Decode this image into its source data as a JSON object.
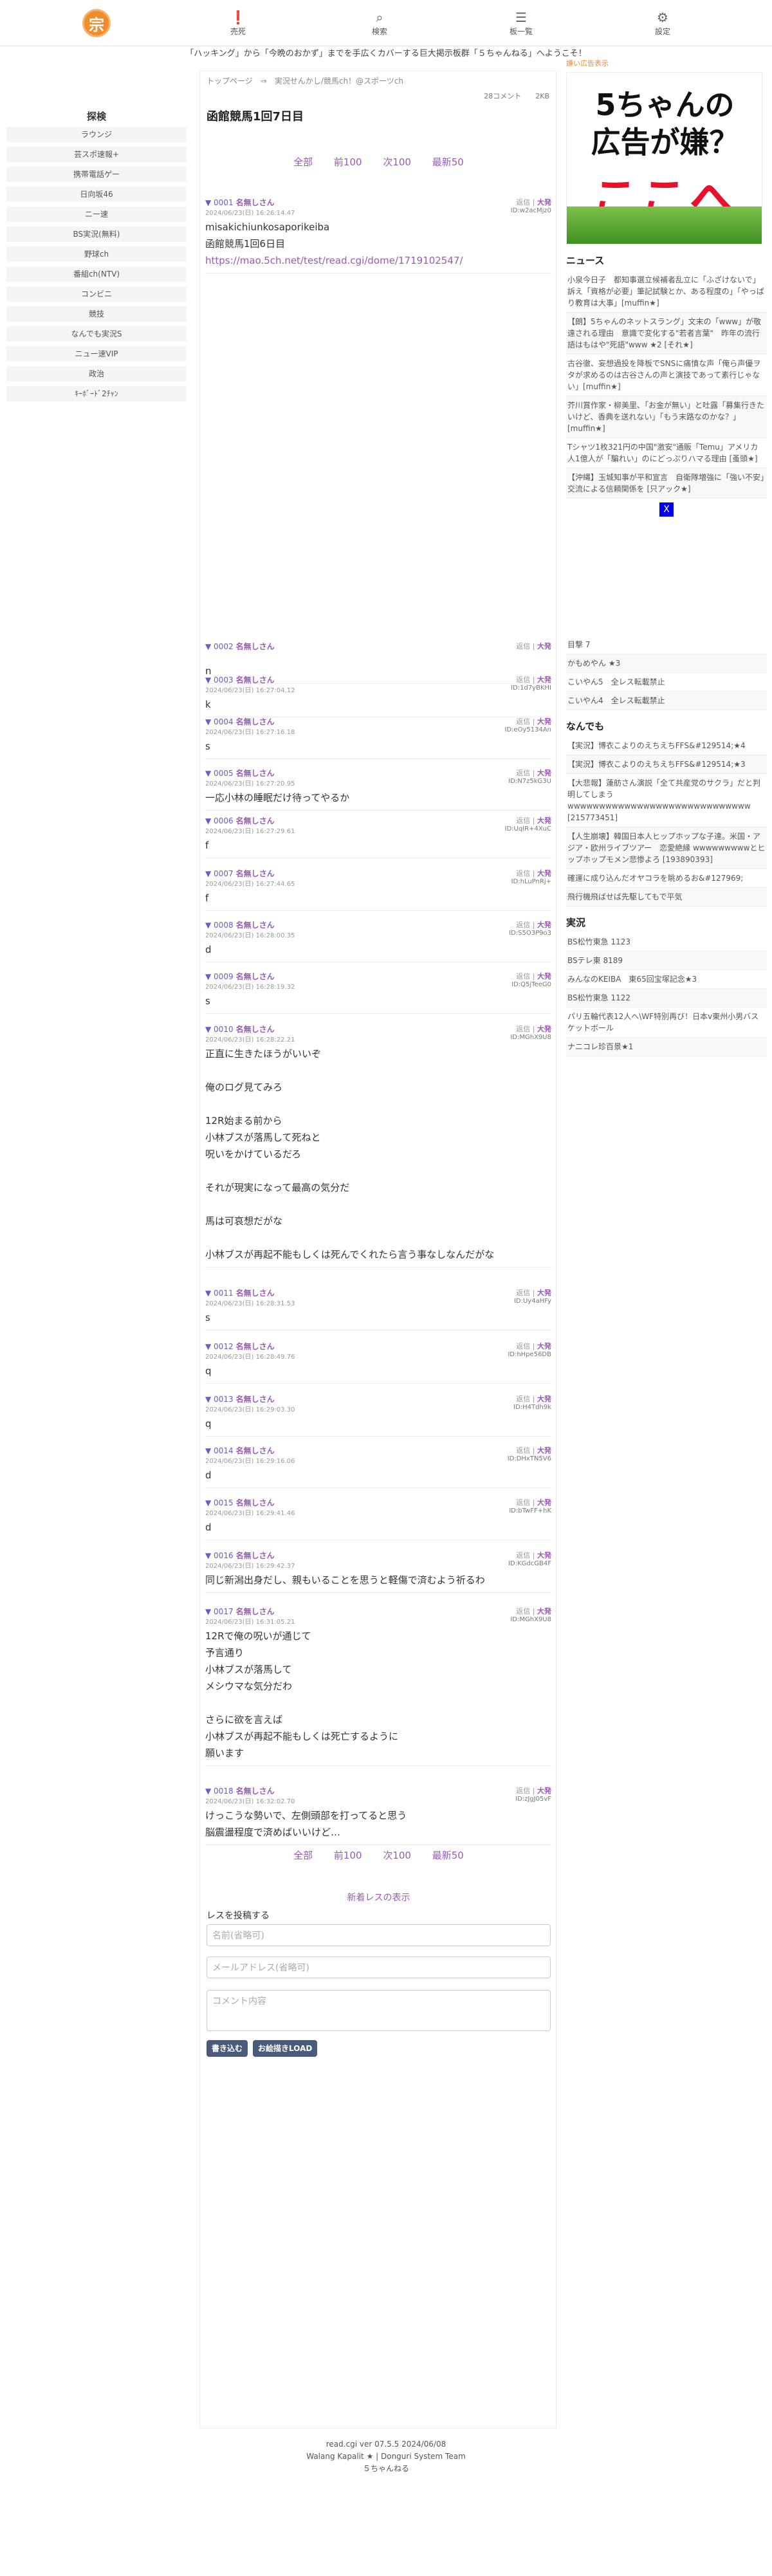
{
  "nav": {
    "logo": "宗",
    "items": [
      "売死",
      "検索",
      "板一覧",
      "設定"
    ]
  },
  "banner": "「ハッキング」から「今晩のおかず」までを手広くカバーする巨大掲示板群「５ちゃんねる」へようこそ！",
  "left": {
    "head": "探検",
    "cats": [
      "ラウンジ",
      "芸スポ速報+",
      "携帯電話ゲー",
      "日向坂46",
      "ニー速",
      "BS実況(無料)",
      "野球ch",
      "番組ch(NTV)",
      "コンビニ",
      "競技",
      "なんでも実況S",
      "ニュー速VIP",
      "政治",
      "ｷｰﾎﾞｰﾄﾞ2ﾁｬﾝ"
    ]
  },
  "main": {
    "crumb": "トップページ　⇒　実況せんかし/競馬ch！@スポーツch",
    "meta": "28コメント　　2KB",
    "title": "函館競馬1回7日目",
    "pager": {
      "all": "全部",
      "prev": "前100",
      "next": "次100",
      "latest": "最新50"
    },
    "posts": [
      {
        "num": "0001",
        "name": "名無しさん",
        "date": "2024/06/23(日) 16:26:14.47",
        "uid": "ID:w2acMjz0",
        "body": "misakichiunkosaporikeiba\n函館競馬1回6日目",
        "link": "https://mao.5ch.net/test/read.cgi/dome/1719102547/"
      },
      {
        "num": "0002",
        "name": "名無しさん",
        "date": "",
        "uid": "",
        "body": "n"
      },
      {
        "num": "0003",
        "name": "名無しさん",
        "date": "2024/06/23(日) 16:27:04.12",
        "uid": "ID:1d7yBKHI",
        "body": "k"
      },
      {
        "num": "0004",
        "name": "名無しさん",
        "date": "2024/06/23(日) 16:27:16.18",
        "uid": "ID:eOy5134An",
        "body": "s"
      },
      {
        "num": "0005",
        "name": "名無しさん",
        "date": "2024/06/23(日) 16:27:20.95",
        "uid": "ID:N7z5kG3U",
        "body": "一応小林の睡眠だけ待ってやるか"
      },
      {
        "num": "0006",
        "name": "名無しさん",
        "date": "2024/06/23(日) 16:27:29.61",
        "uid": "ID:UqIR+4XuC",
        "body": "f"
      },
      {
        "num": "0007",
        "name": "名無しさん",
        "date": "2024/06/23(日) 16:27:44.65",
        "uid": "ID:hLuPnRj+",
        "body": "f"
      },
      {
        "num": "0008",
        "name": "名無しさん",
        "date": "2024/06/23(日) 16:28:00.35",
        "uid": "ID:S5O3P9o3",
        "body": "d"
      },
      {
        "num": "0009",
        "name": "名無しさん",
        "date": "2024/06/23(日) 16:28:19.32",
        "uid": "ID:Q5jTeeG0",
        "body": "s"
      },
      {
        "num": "0010",
        "name": "名無しさん",
        "date": "2024/06/23(日) 16:28:22.21",
        "uid": "ID:MGhX9U8",
        "body": "正直に生きたほうがいいぞ\n\n俺のログ見てみろ\n\n12R始まる前から\n小林ブスが落馬して死ねと\n呪いをかけているだろ\n\nそれが現実になって最高の気分だ\n\n馬は可哀想だがな\n\n小林ブスが再起不能もしくは死んでくれたら言う事なしなんだがな"
      },
      {
        "num": "0011",
        "name": "名無しさん",
        "date": "2024/06/23(日) 16:28:31.53",
        "uid": "ID:Uy4aHFy",
        "body": "s"
      },
      {
        "num": "0012",
        "name": "名無しさん",
        "date": "2024/06/23(日) 16:28:49.76",
        "uid": "ID:hHpe56DB",
        "body": "q"
      },
      {
        "num": "0013",
        "name": "名無しさん",
        "date": "2024/06/23(日) 16:29:03.30",
        "uid": "ID:H4Tdh9k",
        "body": "q"
      },
      {
        "num": "0014",
        "name": "名無しさん",
        "date": "2024/06/23(日) 16:29:16.06",
        "uid": "ID:DHxTN5V6",
        "body": "d"
      },
      {
        "num": "0015",
        "name": "名無しさん",
        "date": "2024/06/23(日) 16:29:41.46",
        "uid": "ID:bTwFF+hK",
        "body": "d"
      },
      {
        "num": "0016",
        "name": "名無しさん",
        "date": "2024/06/23(日) 16:29:42.37",
        "uid": "ID:KGdcGB4F",
        "body": "同じ新潟出身だし、親もいることを思うと軽傷で済むよう祈るわ"
      },
      {
        "num": "0017",
        "name": "名無しさん",
        "date": "2024/06/23(日) 16:31:05.21",
        "uid": "ID:MGhX9U8",
        "body": "12Rで俺の呪いが通じて\n予言通り\n小林ブスが落馬して\nメシウマな気分だわ\n\nさらに欲を言えば\n小林ブスが再起不能もしくは死亡するように\n願います"
      },
      {
        "num": "0018",
        "name": "名無しさん",
        "date": "2024/06/23(日) 16:32:02.70",
        "uid": "ID:zJgJ05vF",
        "body": "けっこうな勢いで、左側頭部を打ってると思う\n脳震盪程度で済めばいいけど…"
      }
    ],
    "reply_label": "返信",
    "count_label": "大発",
    "show_new": "新着レスの表示",
    "post_label": "レスを投稿する",
    "name_ph": "名前(省略可)",
    "mail_ph": "メールアドレス(省略可)",
    "comment_ph": "コメント内容",
    "submit": "書き込む",
    "load": "お絵描きLOAD"
  },
  "right": {
    "ad_label": "嫌い広告表示",
    "ad_line1": "5ちゃんの",
    "ad_line2": "広告が嫌？",
    "ad_line3": "ここへ",
    "news_head": "ニュース",
    "news": [
      "小泉今日子　都知事選立候補者乱立に「ふざけないで」訴え「資格が必要」筆記試験とか、ある程度の」「やっぱり教育は大事」[muffin★]",
      "【朗】5ちゃんのネットスラング」文末の「www」が敬遠される理由　意識で変化する\"若者言葉\"　昨年の流行語はもはや\"死語\"www ★2 [それ★]",
      "古谷徹、妄想過投を降板でSNSに痛憤な声「俺ら声優ヲタが求めるのは古谷さんの声と演技であって素行じゃない」[muffin★]",
      "芥川賞作家・柳美里、「お金が無い」と吐露「募集行きたいけど、香典を送れない」「もう末路なのかな？」[muffin★]",
      "Tシャツ1枚321円の中国\"激安\"通販「Temu」アメリカ人1億人が「騙れい」のにどっぷりハマる理由 [蚤頭★]",
      "【沖縄】玉城知事が平和宣言　自衛隊増強に「強い不安」　交流による信頼関係を [只アック★]"
    ],
    "close": "X",
    "lower_top": [
      "目撃 7",
      "かもめやん ★3",
      "こいやん5　全レス転載禁止",
      "こいやん4　全レス転載禁止"
    ],
    "nandemo_head": "なんでも",
    "nandemo": [
      "【実況】博衣こよりのえちえちFFS&#129514;★4",
      "【実況】博衣こよりのえちえちFFS&#129514;★3",
      "【大悲報】蓮舫さん演説「全て共産党のサクラ」だと判明してしまう wwwwwwwwwwwwwwwwwwwwwwwwwwwww [215773451]",
      "【人生崩壊】韓国日本人ヒップホップな子達。米国・アジア・欧州ライブツアー　恋愛絶縁 wwwwwwwwwとヒップホップモメン悲惨よろ [193890393]",
      "確運に成り込んだオヤコラを眺めるお&#127969;",
      "飛行機飛ばせば先駆してもで平気"
    ],
    "jikkyo_head": "実況",
    "jikkyo": [
      "BS松竹東急 1123",
      "BSテレ東 8189",
      "みんなのKEIBA　東65回宝塚記念★3",
      "BS松竹東急 1122",
      "パリ五輪代表12人へ\\WF特別再び！日本v東州小男バスケットボール",
      "ナニコレ珍百景★1"
    ]
  },
  "footer": [
    "read.cgi ver 07.5.5 2024/06/08",
    "Walang Kapalit ★ | Donguri System Team",
    "５ちゃんねる"
  ]
}
